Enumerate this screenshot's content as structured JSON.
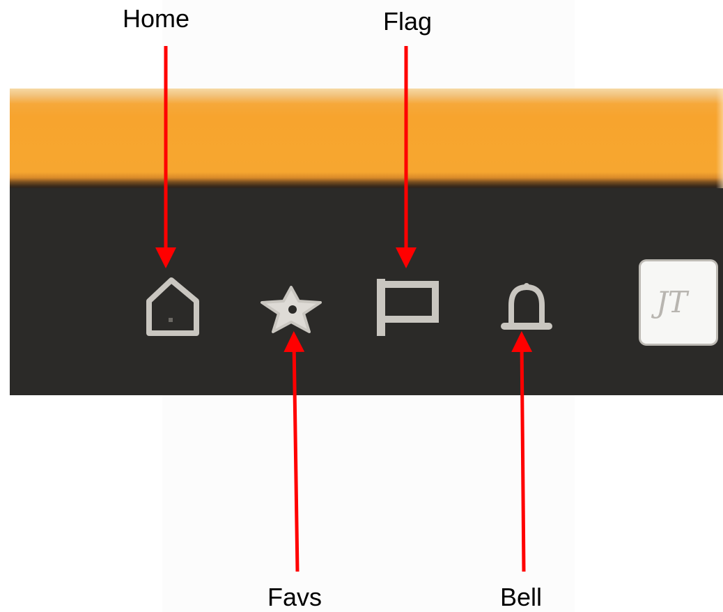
{
  "annotations": {
    "home": "Home",
    "flag": "Flag",
    "favs": "Favs",
    "bell": "Bell"
  },
  "avatar": {
    "initials": "JT"
  },
  "toolbar": {
    "icons": [
      "home-icon",
      "star-icon",
      "flag-icon",
      "bell-icon"
    ]
  },
  "colors": {
    "orange_bar": "#f7a62f",
    "toolbar_bg": "#2b2a28",
    "icon": "#c9c6c0",
    "arrow": "#ff0000"
  }
}
